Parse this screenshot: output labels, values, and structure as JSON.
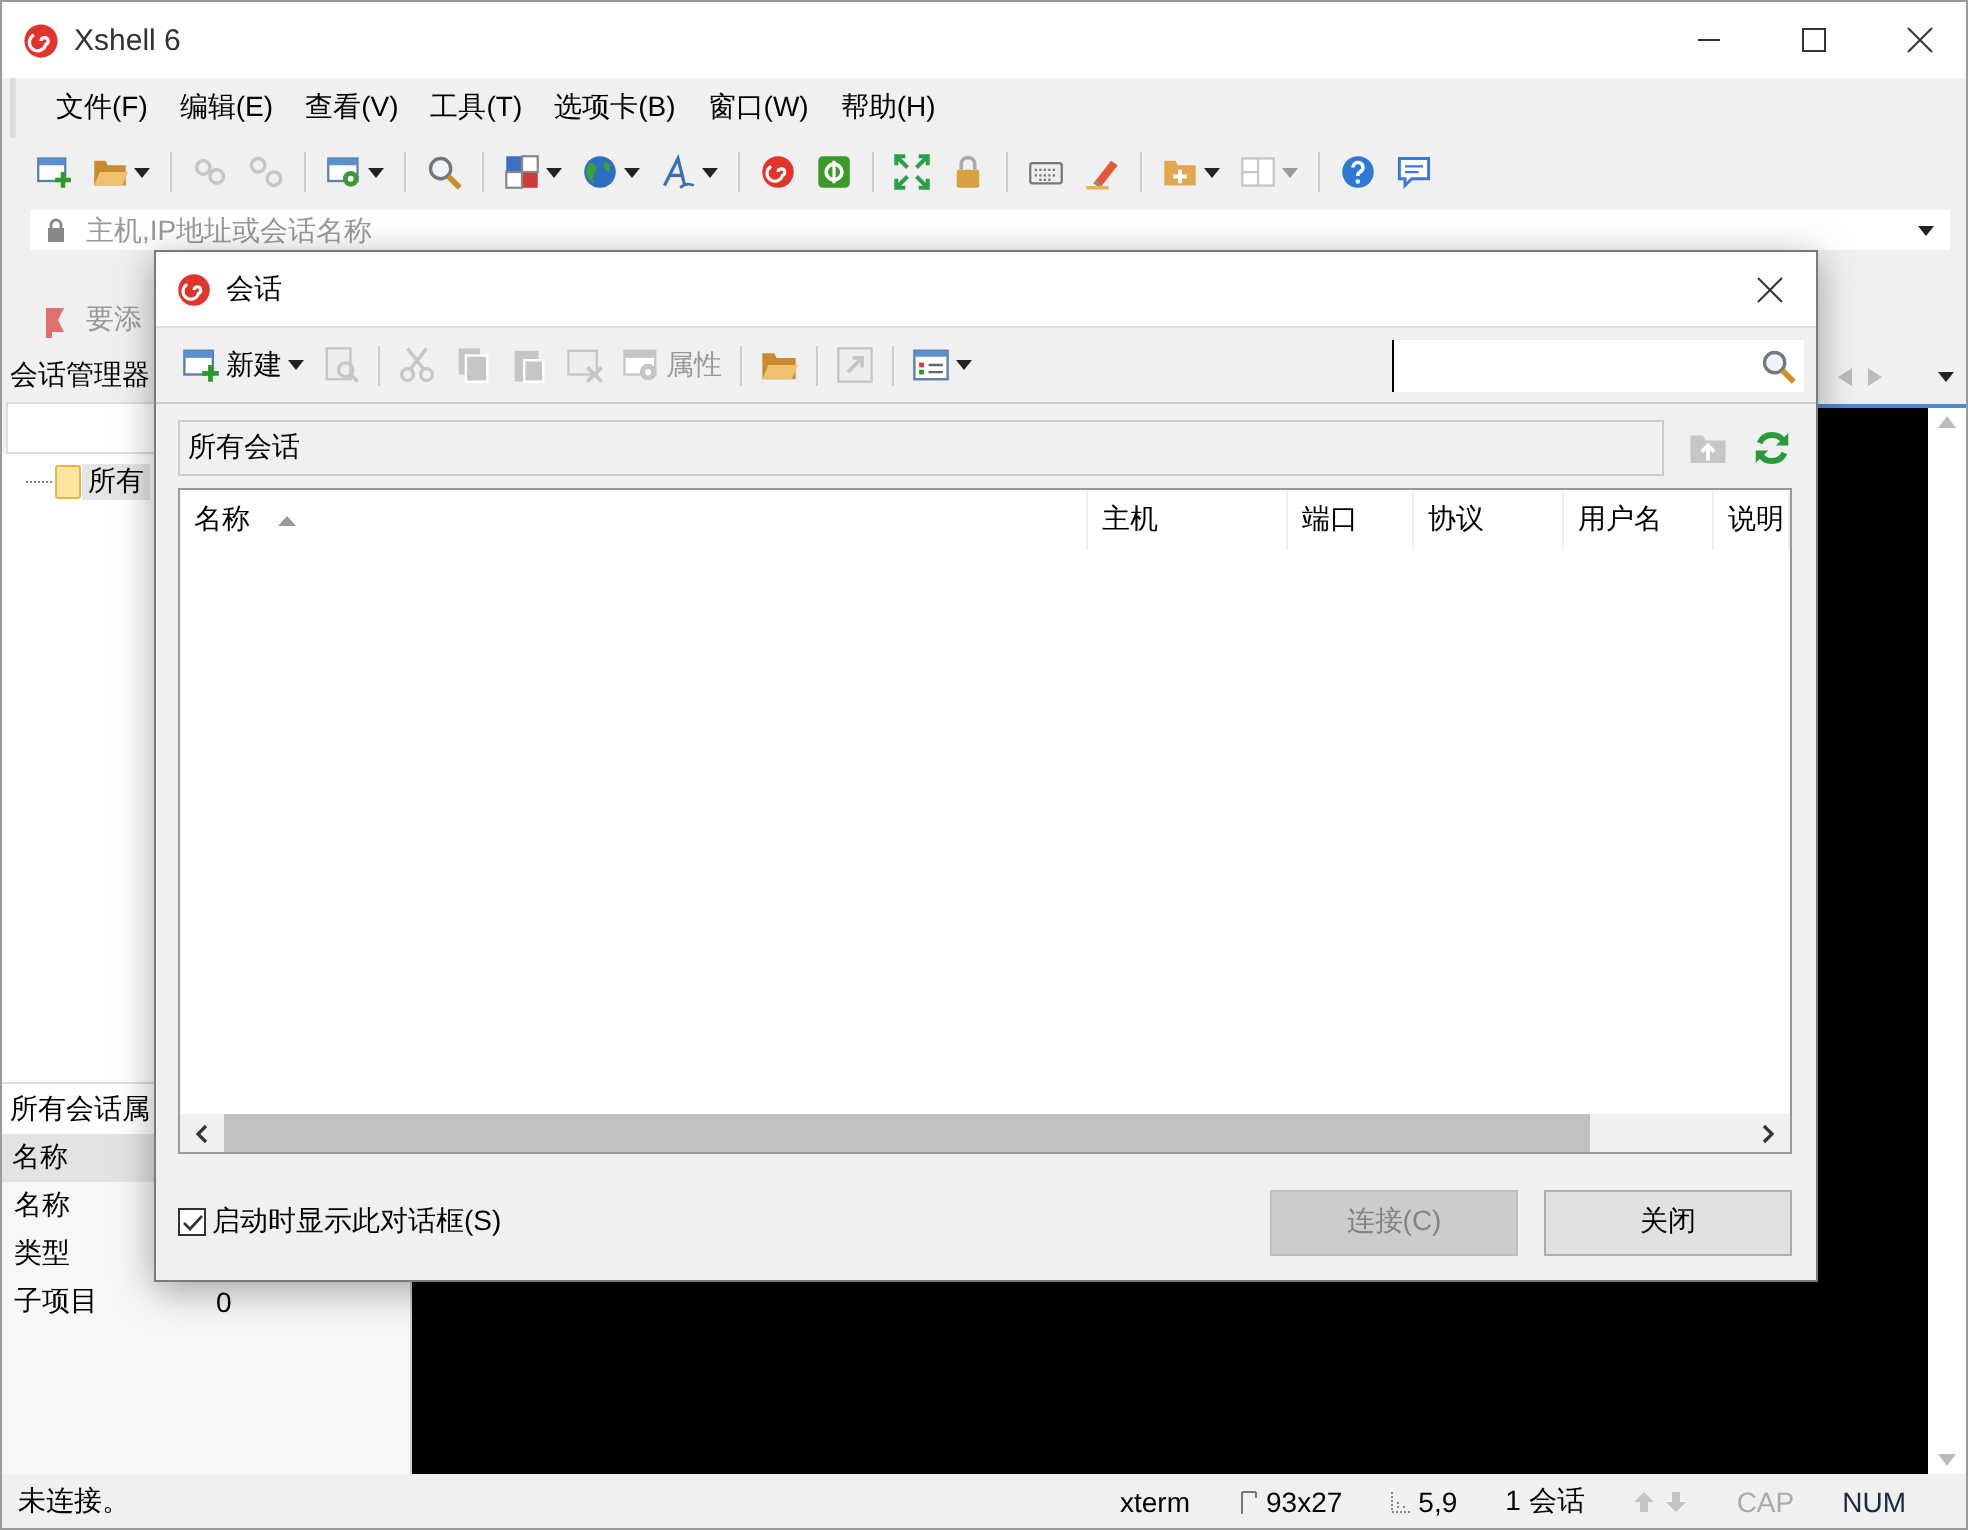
{
  "window": {
    "title": "Xshell 6"
  },
  "menu": [
    "文件(F)",
    "编辑(E)",
    "查看(V)",
    "工具(T)",
    "选项卡(B)",
    "窗口(W)",
    "帮助(H)"
  ],
  "toolbar": [
    {
      "kind": "new",
      "disabled": false,
      "caret": false
    },
    {
      "kind": "open",
      "disabled": false,
      "caret": true
    },
    {
      "kind": "separator"
    },
    {
      "kind": "link",
      "disabled": true,
      "caret": false
    },
    {
      "kind": "unlink",
      "disabled": true,
      "caret": false
    },
    {
      "kind": "separator"
    },
    {
      "kind": "properties",
      "disabled": false,
      "caret": true
    },
    {
      "kind": "separator"
    },
    {
      "kind": "search",
      "disabled": false,
      "caret": false
    },
    {
      "kind": "separator"
    },
    {
      "kind": "colors",
      "disabled": false,
      "caret": true
    },
    {
      "kind": "globe",
      "disabled": false,
      "caret": true
    },
    {
      "kind": "font",
      "disabled": false,
      "caret": true
    },
    {
      "kind": "separator"
    },
    {
      "kind": "spiral",
      "disabled": false,
      "caret": false
    },
    {
      "kind": "square_logo",
      "disabled": false,
      "caret": false
    },
    {
      "kind": "separator"
    },
    {
      "kind": "fullscreen",
      "disabled": false,
      "caret": false
    },
    {
      "kind": "lock",
      "disabled": false,
      "caret": false
    },
    {
      "kind": "separator"
    },
    {
      "kind": "keyboard",
      "disabled": false,
      "caret": false
    },
    {
      "kind": "highlighter",
      "disabled": false,
      "caret": false
    },
    {
      "kind": "separator"
    },
    {
      "kind": "folder_plus",
      "disabled": false,
      "caret": true
    },
    {
      "kind": "layout",
      "disabled": true,
      "caret": true
    },
    {
      "kind": "separator"
    },
    {
      "kind": "help",
      "disabled": false,
      "caret": false
    },
    {
      "kind": "chat",
      "disabled": false,
      "caret": false
    }
  ],
  "address_bar": {
    "placeholder": "主机,IP地址或会话名称"
  },
  "links_bar": {
    "text": "要添"
  },
  "session_manager": {
    "title": "会话管理器",
    "tree": [
      {
        "label": "所有",
        "selected": true
      }
    ],
    "properties": {
      "title": "所有会话属",
      "column": "名称",
      "rows": [
        {
          "name": "名称"
        },
        {
          "name": "类型"
        },
        {
          "name": "子项目",
          "value": "0"
        }
      ]
    }
  },
  "status_bar": {
    "message": "未连接。",
    "items": [
      {
        "kind": "text",
        "text": "xterm"
      },
      {
        "kind": "size",
        "text": "93x27"
      },
      {
        "kind": "cursor",
        "text": "5,9"
      },
      {
        "kind": "text",
        "text": "1 会话"
      },
      {
        "kind": "arrows",
        "disabled": true
      },
      {
        "kind": "key",
        "text": "CAP",
        "on": false
      },
      {
        "kind": "key",
        "text": "NUM",
        "on": true
      }
    ]
  },
  "dialog": {
    "title": "会话",
    "toolbar": [
      {
        "kind": "new",
        "label": "新建",
        "caret": true,
        "disabled": false
      },
      {
        "kind": "page",
        "caret": false,
        "disabled": true
      },
      {
        "kind": "separator"
      },
      {
        "kind": "cut",
        "caret": false,
        "disabled": true
      },
      {
        "kind": "copy",
        "caret": false,
        "disabled": true
      },
      {
        "kind": "paste",
        "caret": false,
        "disabled": true
      },
      {
        "kind": "delete",
        "caret": false,
        "disabled": true
      },
      {
        "kind": "properties",
        "label": "属性",
        "caret": false,
        "disabled": true
      },
      {
        "kind": "separator"
      },
      {
        "kind": "open",
        "caret": false,
        "disabled": false
      },
      {
        "kind": "separator"
      },
      {
        "kind": "export",
        "caret": false,
        "disabled": true
      },
      {
        "kind": "separator"
      },
      {
        "kind": "view",
        "caret": true,
        "disabled": false
      }
    ],
    "path": "所有会话",
    "path_buttons": [
      {
        "kind": "up",
        "disabled": true
      },
      {
        "kind": "refresh",
        "disabled": false
      }
    ],
    "columns": [
      {
        "label": "名称",
        "sorted": true
      },
      {
        "label": "主机",
        "sorted": false
      },
      {
        "label": "端口",
        "sorted": false
      },
      {
        "label": "协议",
        "sorted": false
      },
      {
        "label": "用户名",
        "sorted": false
      },
      {
        "label": "说明",
        "sorted": false
      }
    ],
    "startup_checkbox": {
      "label": "启动时显示此对话框(S)",
      "checked": true
    },
    "buttons": [
      {
        "label": "连接(C)",
        "disabled": true
      },
      {
        "label": "关闭",
        "disabled": false
      }
    ]
  }
}
